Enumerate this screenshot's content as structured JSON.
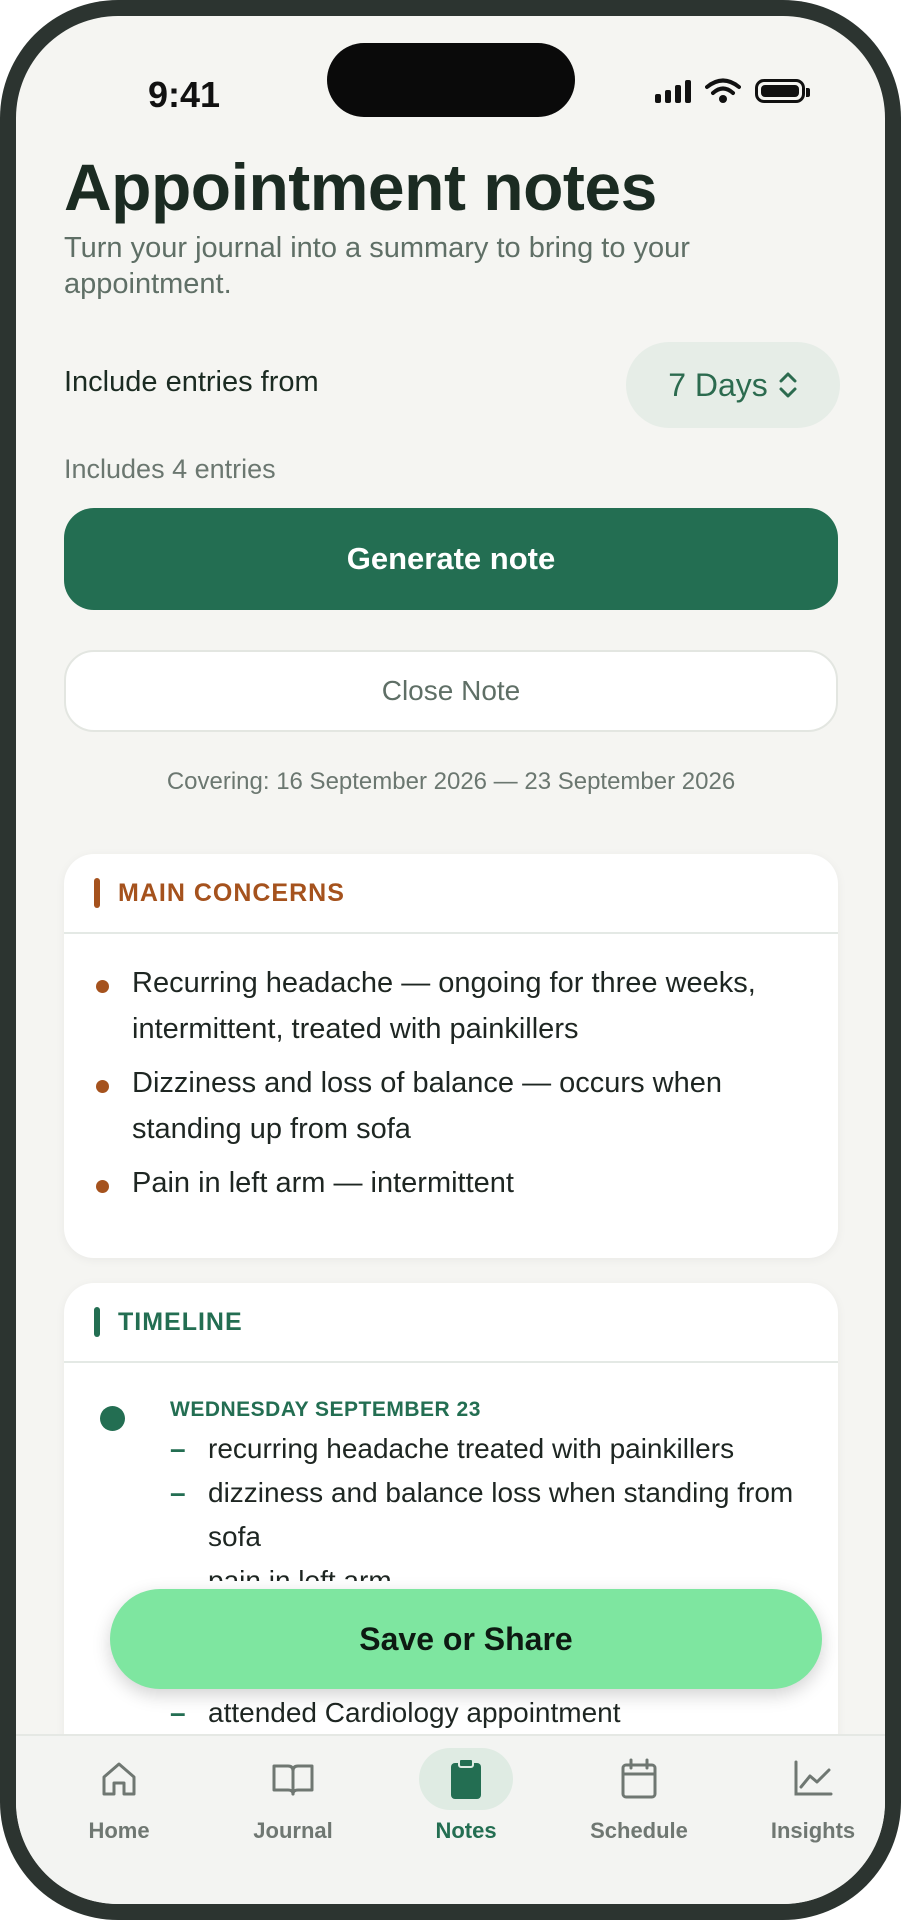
{
  "status_bar": {
    "time": "9:41"
  },
  "header": {
    "title": "Appointment notes",
    "subtitle": "Turn your journal into a summary to bring to your appointment."
  },
  "range": {
    "label": "Include entries from",
    "selected": "7 Days",
    "entries_count": "Includes 4 entries"
  },
  "actions": {
    "generate_label": "Generate note",
    "close_label": "Close Note",
    "save_share_label": "Save or Share"
  },
  "covering": "Covering: 16 September 2026 — 23 September 2026",
  "main_concerns": {
    "title": "MAIN CONCERNS",
    "items": [
      "Recurring headache — ongoing for three weeks, intermittent, treated with painkillers",
      "Dizziness and loss of balance — occurs when standing up from sofa",
      "Pain in left arm — intermittent"
    ]
  },
  "timeline": {
    "title": "TIMELINE",
    "date": "WEDNESDAY SEPTEMBER 23",
    "items": [
      "recurring headache treated with painkillers",
      "dizziness and balance loss when standing from sofa",
      "pain in left arm",
      "attended Cardiology appointment"
    ]
  },
  "tabs": [
    {
      "label": "Home",
      "icon": "home-icon",
      "active": false
    },
    {
      "label": "Journal",
      "icon": "book-icon",
      "active": false
    },
    {
      "label": "Notes",
      "icon": "clipboard-icon",
      "active": true
    },
    {
      "label": "Schedule",
      "icon": "calendar-icon",
      "active": false
    },
    {
      "label": "Insights",
      "icon": "chart-icon",
      "active": false
    }
  ],
  "colors": {
    "primary": "#236e52",
    "accent_concern": "#a5521d",
    "save_button": "#7ee6a0",
    "background": "#f5f5f2"
  }
}
